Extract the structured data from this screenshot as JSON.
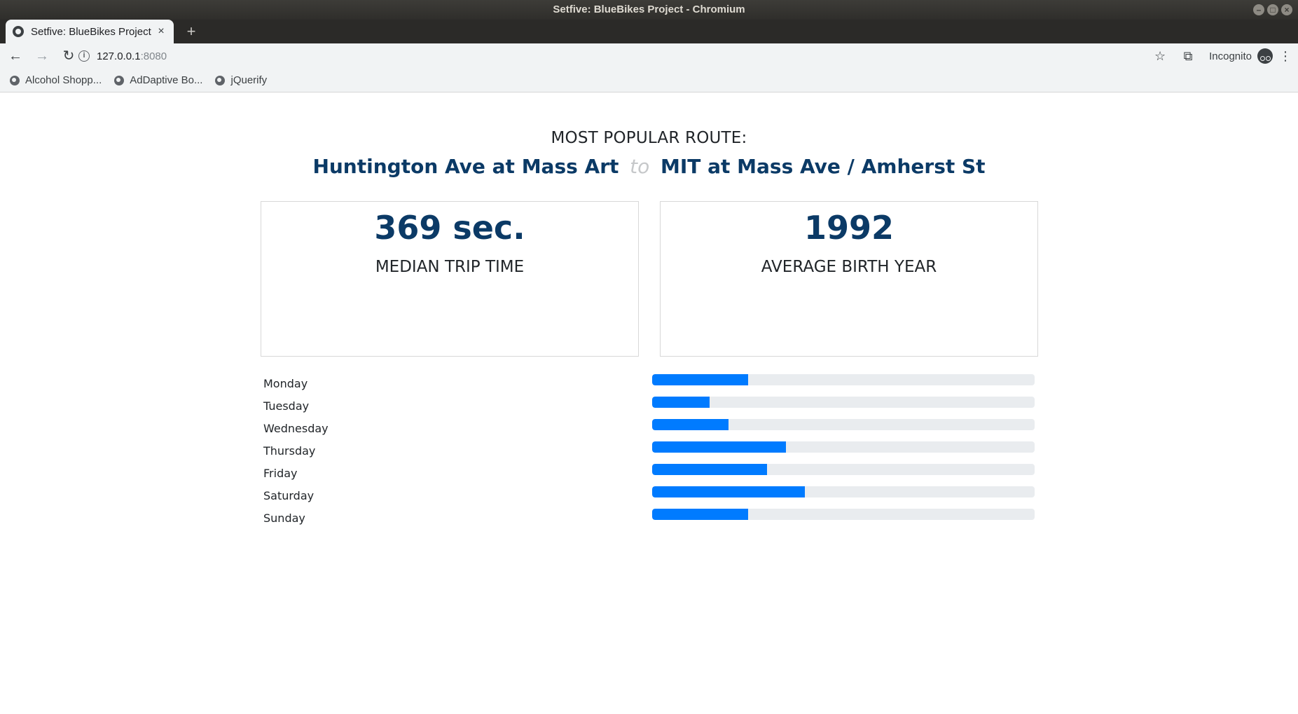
{
  "window": {
    "title": "Setfive: BlueBikes Project - Chromium"
  },
  "browser": {
    "tab_title": "Setfive: BlueBikes Project",
    "tab_close": "×",
    "new_tab": "+",
    "url_host": "127.0.0.1",
    "url_port": ":8080",
    "incognito_label": "Incognito",
    "bookmarks": [
      {
        "label": "Alcohol Shopp..."
      },
      {
        "label": "AdDaptive Bo..."
      },
      {
        "label": "jQuerify"
      }
    ]
  },
  "page": {
    "route_heading": "MOST POPULAR ROUTE:",
    "route_from": "Huntington Ave at Mass Art",
    "route_to_word": "to",
    "route_to": "MIT at Mass Ave / Amherst St",
    "stats": {
      "median_trip_value": "369 sec.",
      "median_trip_label": "MEDIAN TRIP TIME",
      "birth_year_value": "1992",
      "birth_year_label": "AVERAGE BIRTH YEAR"
    },
    "colors": {
      "accent_dark": "#0b3a66",
      "bar_fill": "#007bff",
      "bar_track": "#e9ecef"
    },
    "days": [
      {
        "label": "Monday",
        "percent": 25
      },
      {
        "label": "Tuesday",
        "percent": 15
      },
      {
        "label": "Wednesday",
        "percent": 20
      },
      {
        "label": "Thursday",
        "percent": 35
      },
      {
        "label": "Friday",
        "percent": 30
      },
      {
        "label": "Saturday",
        "percent": 40
      },
      {
        "label": "Sunday",
        "percent": 25
      }
    ]
  }
}
